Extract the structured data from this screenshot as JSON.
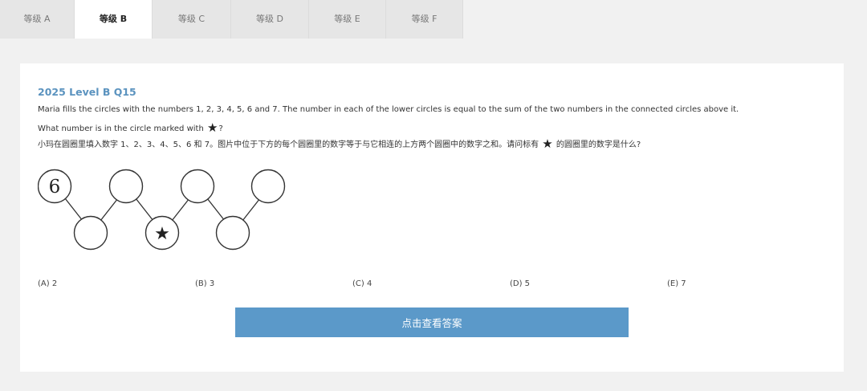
{
  "tabs": [
    {
      "label": "等级 A",
      "active": false
    },
    {
      "label": "等级 B",
      "active": true
    },
    {
      "label": "等级 C",
      "active": false
    },
    {
      "label": "等级 D",
      "active": false
    },
    {
      "label": "等级 E",
      "active": false
    },
    {
      "label": "等级 F",
      "active": false
    }
  ],
  "question": {
    "title": "2025 Level B Q15",
    "text_en_1": "Maria fills the circles with the numbers 1, 2, 3, 4, 5, 6 and 7. The number in each of the lower circles is equal to the sum of the two numbers in the connected circles above it.",
    "text_en_2a": "What number is in the circle marked with ",
    "text_en_2b": "?",
    "text_zh_a": "小玛在圆圈里填入数字 1、2、3、4、5、6 和 7。图片中位于下方的每个圆圈里的数字等于与它相连的上方两个圆圈中的数字之和。请问标有",
    "text_zh_b": "的圆圈里的数字是什么?",
    "star_symbol": "★",
    "diagram": {
      "top_circles": [
        "6",
        "",
        "",
        ""
      ],
      "bottom_circles": [
        "",
        "★",
        ""
      ]
    }
  },
  "options": [
    "(A) 2",
    "(B) 3",
    "(C) 4",
    "(D) 5",
    "(E) 7"
  ],
  "answer_button": "点击查看答案",
  "colors": {
    "title": "#5b93bf",
    "button": "#5b99c9",
    "background": "#f1f1f1",
    "tab_inactive": "#e6e6e6"
  }
}
